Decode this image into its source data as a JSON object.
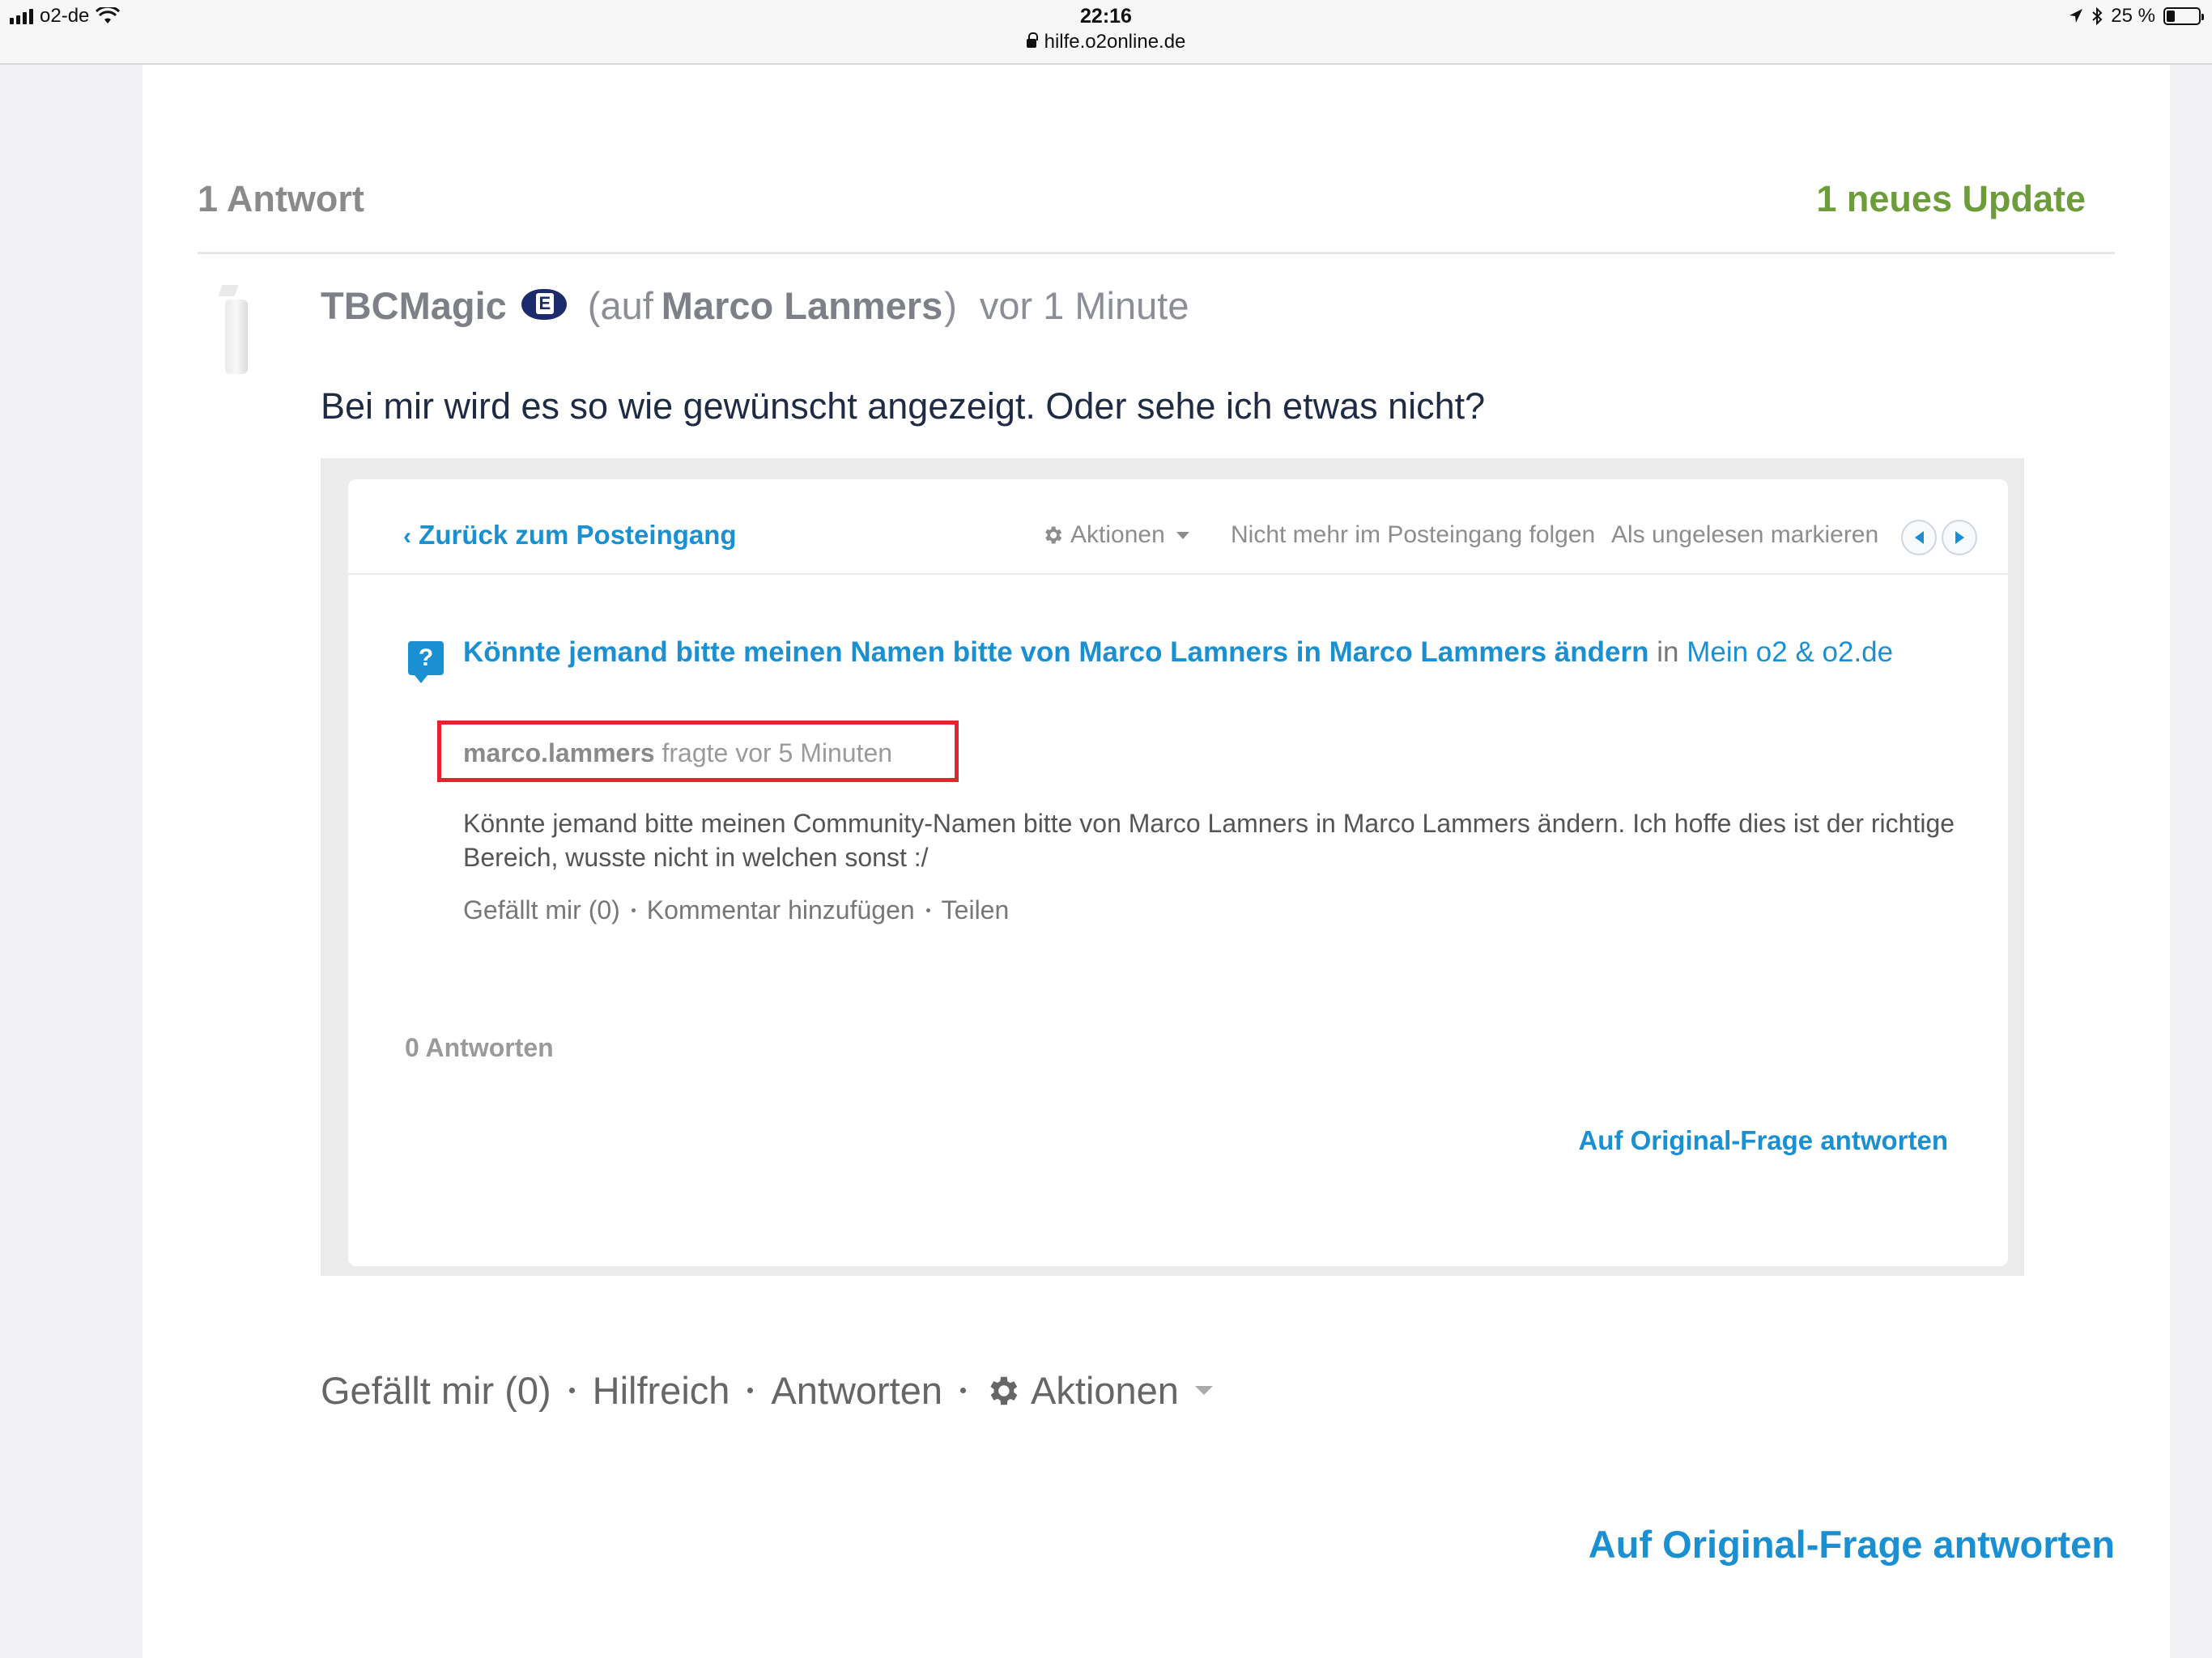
{
  "status_bar": {
    "carrier": "o2-de",
    "time": "22:16",
    "url": "hilfe.o2online.de",
    "battery": "25 %",
    "battery_level": 0.25
  },
  "thread": {
    "answers_count": "1 Antwort",
    "new_updates": "1 neues Update"
  },
  "post": {
    "author": "TBCMagic",
    "badge_letter": "E",
    "reply_open": "(auf",
    "reply_to": "Marco Lanmers",
    "reply_close": ")",
    "time": "vor 1 Minute",
    "text": "Bei mir wird es so wie gewünscht angezeigt. Oder sehe ich etwas nicht?"
  },
  "screenshot": {
    "back_label": "Zurück zum Posteingang",
    "actions_label": "Aktionen",
    "unfollow_label": "Nicht mehr im Posteingang folgen",
    "mark_unread_label": "Als ungelesen markieren",
    "question_title": "Könnte jemand bitte meinen Namen bitte von Marco Lamners in Marco Lammers ändern",
    "question_in": "in",
    "question_category": "Mein o2 & o2.de",
    "asker_name": "marco.lammers",
    "asker_meta": "fragte vor 5 Minuten",
    "question_body": "Könnte jemand bitte meinen Community-Namen bitte von Marco Lamners in Marco Lammers ändern. Ich hoffe dies ist der richtige Bereich, wusste nicht in welchen sonst :/",
    "like_label": "Gefällt mir (0)",
    "comment_label": "Kommentar hinzufügen",
    "share_label": "Teilen",
    "answers_label": "0 Antworten",
    "reply_label": "Auf Original-Frage antworten"
  },
  "post_actions": {
    "like_label": "Gefällt mir (0)",
    "helpful_label": "Hilfreich",
    "reply_label": "Antworten",
    "actions_label": "Aktionen"
  },
  "bottom": {
    "reply_original_label": "Auf Original-Frage antworten"
  },
  "colors": {
    "accent_blue": "#1a8fd2",
    "update_green": "#6d9c3a",
    "highlight_red": "#e3232f",
    "badge_navy": "#1b2b6b"
  },
  "icons": [
    "signal-icon",
    "wifi-icon",
    "lock-icon",
    "location-icon",
    "bluetooth-icon",
    "battery-icon",
    "expert-badge-icon",
    "question-icon",
    "gear-icon",
    "chevron-left-icon",
    "prev-arrow-icon",
    "next-arrow-icon",
    "caret-down-icon"
  ]
}
